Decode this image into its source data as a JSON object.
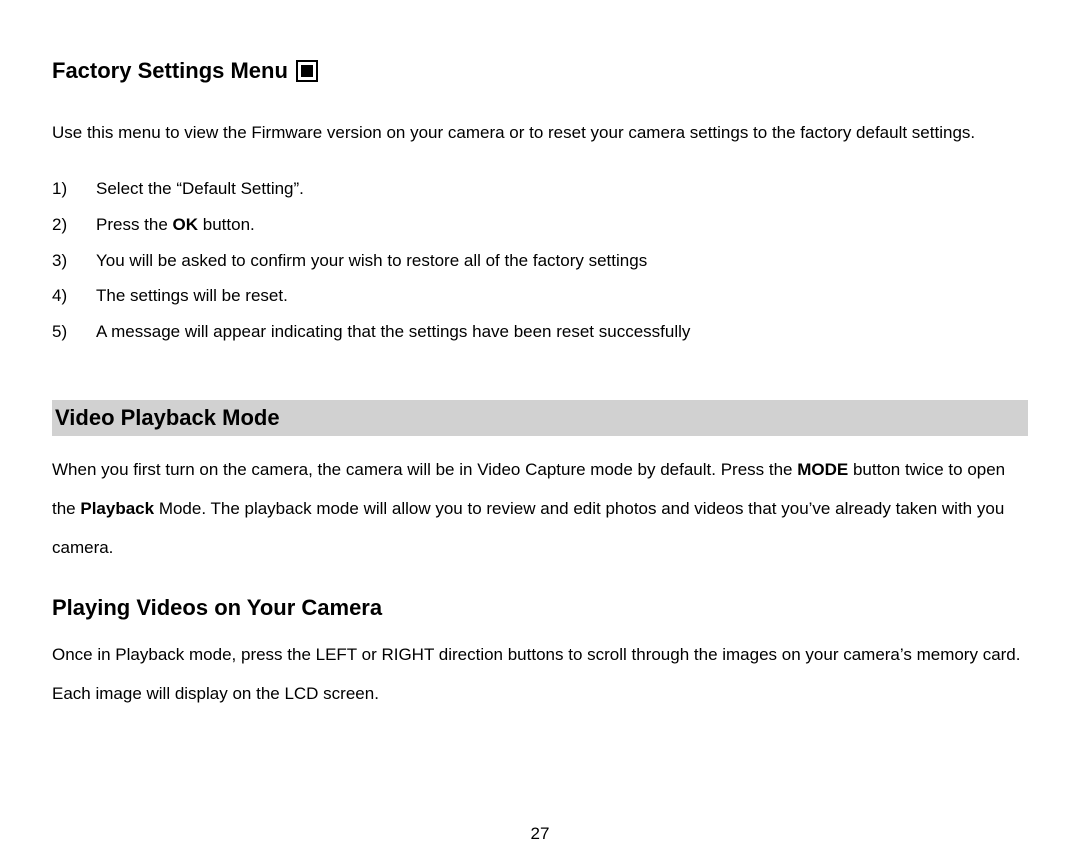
{
  "section1": {
    "heading": "Factory Settings Menu",
    "paragraph": "Use this menu to view the Firmware version on your camera or to reset your camera settings to the factory default settings.",
    "steps": [
      "Select the “Default Setting”.",
      "",
      "You will be asked to confirm your wish to restore all of the factory settings",
      "The settings will be reset.",
      "A message will appear indicating that the settings have been reset successfully"
    ],
    "step2_prefix": "Press the ",
    "step2_bold": "OK",
    "step2_suffix": " button."
  },
  "section2": {
    "heading": "Video Playback Mode",
    "p_part1": "When you first turn on the camera, the camera will be in Video Capture mode by default. Press the ",
    "p_bold1": "MODE",
    "p_part2": " button twice to open the ",
    "p_bold2": "Playback",
    "p_part3": " Mode. The playback mode will allow you to review and edit photos and videos that you’ve already taken with you camera."
  },
  "section3": {
    "heading": "Playing Videos on Your Camera",
    "paragraph": "Once in Playback mode, press the LEFT or RIGHT direction buttons to scroll through the images on your camera’s memory card. Each image will display on the LCD screen."
  },
  "pageNumber": "27"
}
